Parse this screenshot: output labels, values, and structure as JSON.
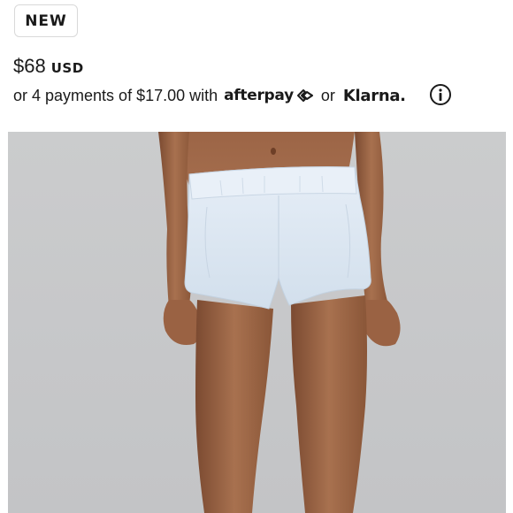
{
  "badge": {
    "label": "NEW"
  },
  "price": {
    "amount": "$68",
    "currency": "USD"
  },
  "payments": {
    "text": "or 4 payments of $17.00 with",
    "afterpay_label": "afterpay",
    "or_text": "or",
    "klarna_label": "Klarna."
  },
  "icons": {
    "afterpay": "afterpay-arrows-icon",
    "info": "info-circle-icon"
  },
  "colors": {
    "text": "#1a1a1a",
    "badge_border": "#d9d9d9",
    "photo_background": "#c8c9cb",
    "shorts": "#dbe6f1"
  }
}
